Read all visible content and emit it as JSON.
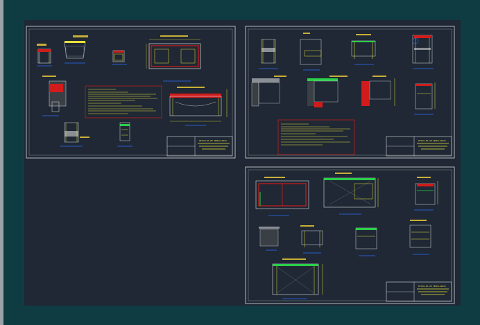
{
  "app": {
    "canvas_background": "#1f2834",
    "frame_color": "#0f3b42",
    "line_colors": {
      "yellow": "#e8e03a",
      "white": "#d9dde2",
      "red": "#d21c1c",
      "green": "#2bd04a",
      "blue": "#2c6cff",
      "gray": "#8a8f96"
    }
  },
  "sheets": [
    {
      "name": "sheet-1",
      "title_block": {
        "title": "DETALLES DE MOBILIARIO"
      }
    },
    {
      "name": "sheet-2",
      "title_block": {
        "title": "DETALLES DE MOBILIARIO"
      }
    },
    {
      "name": "sheet-3",
      "title_block": {
        "title": "DETALLES DE MOBILIARIO"
      }
    }
  ]
}
